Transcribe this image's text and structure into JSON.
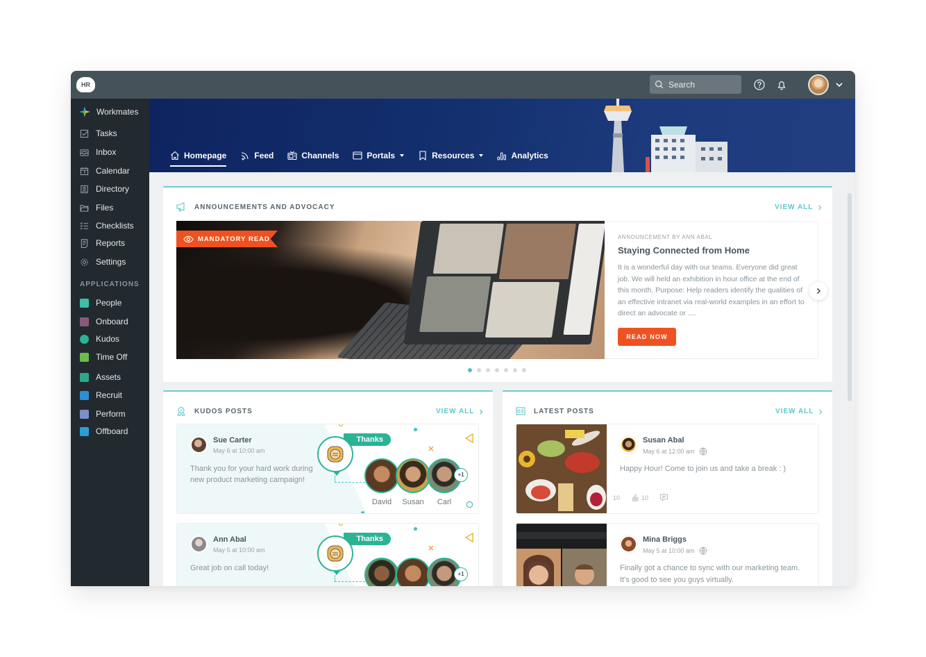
{
  "app": {
    "logo_text": "HR",
    "search": {
      "placeholder": "Search"
    },
    "topbar_icons": [
      "help-icon",
      "bell-icon",
      "user-avatar",
      "chevron-down-icon"
    ]
  },
  "sidebar": {
    "brand": {
      "label": "Workmates",
      "icon": "workmates-logo-icon"
    },
    "items": [
      {
        "label": "Tasks",
        "icon": "checkbox-icon"
      },
      {
        "label": "Inbox",
        "icon": "inbox-icon"
      },
      {
        "label": "Calendar",
        "icon": "calendar-icon"
      },
      {
        "label": "Directory",
        "icon": "contact-card-icon"
      },
      {
        "label": "Files",
        "icon": "folder-icon"
      },
      {
        "label": "Checklists",
        "icon": "checklist-icon"
      },
      {
        "label": "Reports",
        "icon": "report-icon"
      },
      {
        "label": "Settings",
        "icon": "gear-icon"
      }
    ],
    "applications_heading": "APPLICATIONS",
    "applications": [
      {
        "label": "People",
        "icon": "people-app-icon",
        "color": "#3fbfa8"
      },
      {
        "label": "Onboard",
        "icon": "onboard-app-icon",
        "color": "#8a5a7a"
      },
      {
        "label": "Kudos",
        "icon": "kudos-app-icon",
        "color": "#2bb395"
      },
      {
        "label": "Time Off",
        "icon": "timeoff-app-icon",
        "color": "#6dbb4a"
      },
      {
        "label": "Assets",
        "icon": "assets-app-icon",
        "color": "#2fa88a"
      },
      {
        "label": "Recruit",
        "icon": "recruit-app-icon",
        "color": "#2d8fd6"
      },
      {
        "label": "Perform",
        "icon": "perform-app-icon",
        "color": "#7c8fc8"
      },
      {
        "label": "Offboard",
        "icon": "offboard-app-icon",
        "color": "#2a9fd6"
      }
    ]
  },
  "nav": {
    "tabs": [
      {
        "label": "Homepage",
        "icon": "home-icon",
        "active": true
      },
      {
        "label": "Feed",
        "icon": "rss-icon"
      },
      {
        "label": "Channels",
        "icon": "tv-icon"
      },
      {
        "label": "Portals",
        "icon": "browser-window-icon",
        "dropdown": true
      },
      {
        "label": "Resources",
        "icon": "bookmark-icon",
        "dropdown": true
      },
      {
        "label": "Analytics",
        "icon": "bar-chart-icon"
      }
    ]
  },
  "announcements": {
    "title": "ANNOUNCEMENTS AND ADVOCACY",
    "view_all": "VIEW ALL",
    "badge": "MANDATORY READ",
    "byline": "ANNOUNCEMENT BY ANN ABAL",
    "headline": "Staying Connected from Home",
    "body": "It is a wonderful day with our teams. Everyone did great job. We will held an exhibition in hour office at the end of this month. Purpose: Help readers identify the qualities of an effective intranet via real-world examples in an effort to direct an advocate or  ....",
    "cta": "READ NOW",
    "carousel": {
      "total": 7,
      "active_index": 0
    }
  },
  "kudos": {
    "title": "KUDOS POSTS",
    "view_all": "VIEW ALL",
    "posts": [
      {
        "author": "Sue Carter",
        "date": "May 6 at 10:00 am",
        "text": "Thank you for your hard work during new product marketing campaign!",
        "badge": "Thanks",
        "recipients": [
          "David",
          "Susan",
          "Carl"
        ],
        "extra": "+1"
      },
      {
        "author": "Ann Abal",
        "date": "May 5 at 10:00 am",
        "text": "Great job on call today!",
        "badge": "Thanks",
        "recipients": [
          "",
          "",
          ""
        ],
        "extra": "+1"
      }
    ]
  },
  "latest": {
    "title": "LATEST POSTS",
    "view_all": "VIEW ALL",
    "posts": [
      {
        "author": "Susan Abal",
        "date": "May 6 at 12:00 am",
        "text": "Happy Hour! Come to join us and take a break : )",
        "reactions": "10",
        "likes": "10"
      },
      {
        "author": "Mina Briggs",
        "date": "May 5 at 10:00 am",
        "text": "Finally got a chance to sync with our marketing team. It's good to see you guys virtually."
      }
    ]
  },
  "colors": {
    "accent_teal": "#5ec7c8",
    "kudos_green": "#2bb395",
    "cta_orange": "#ef5220",
    "sidebar_bg": "#222a2f",
    "topbar_bg": "#46525a"
  }
}
